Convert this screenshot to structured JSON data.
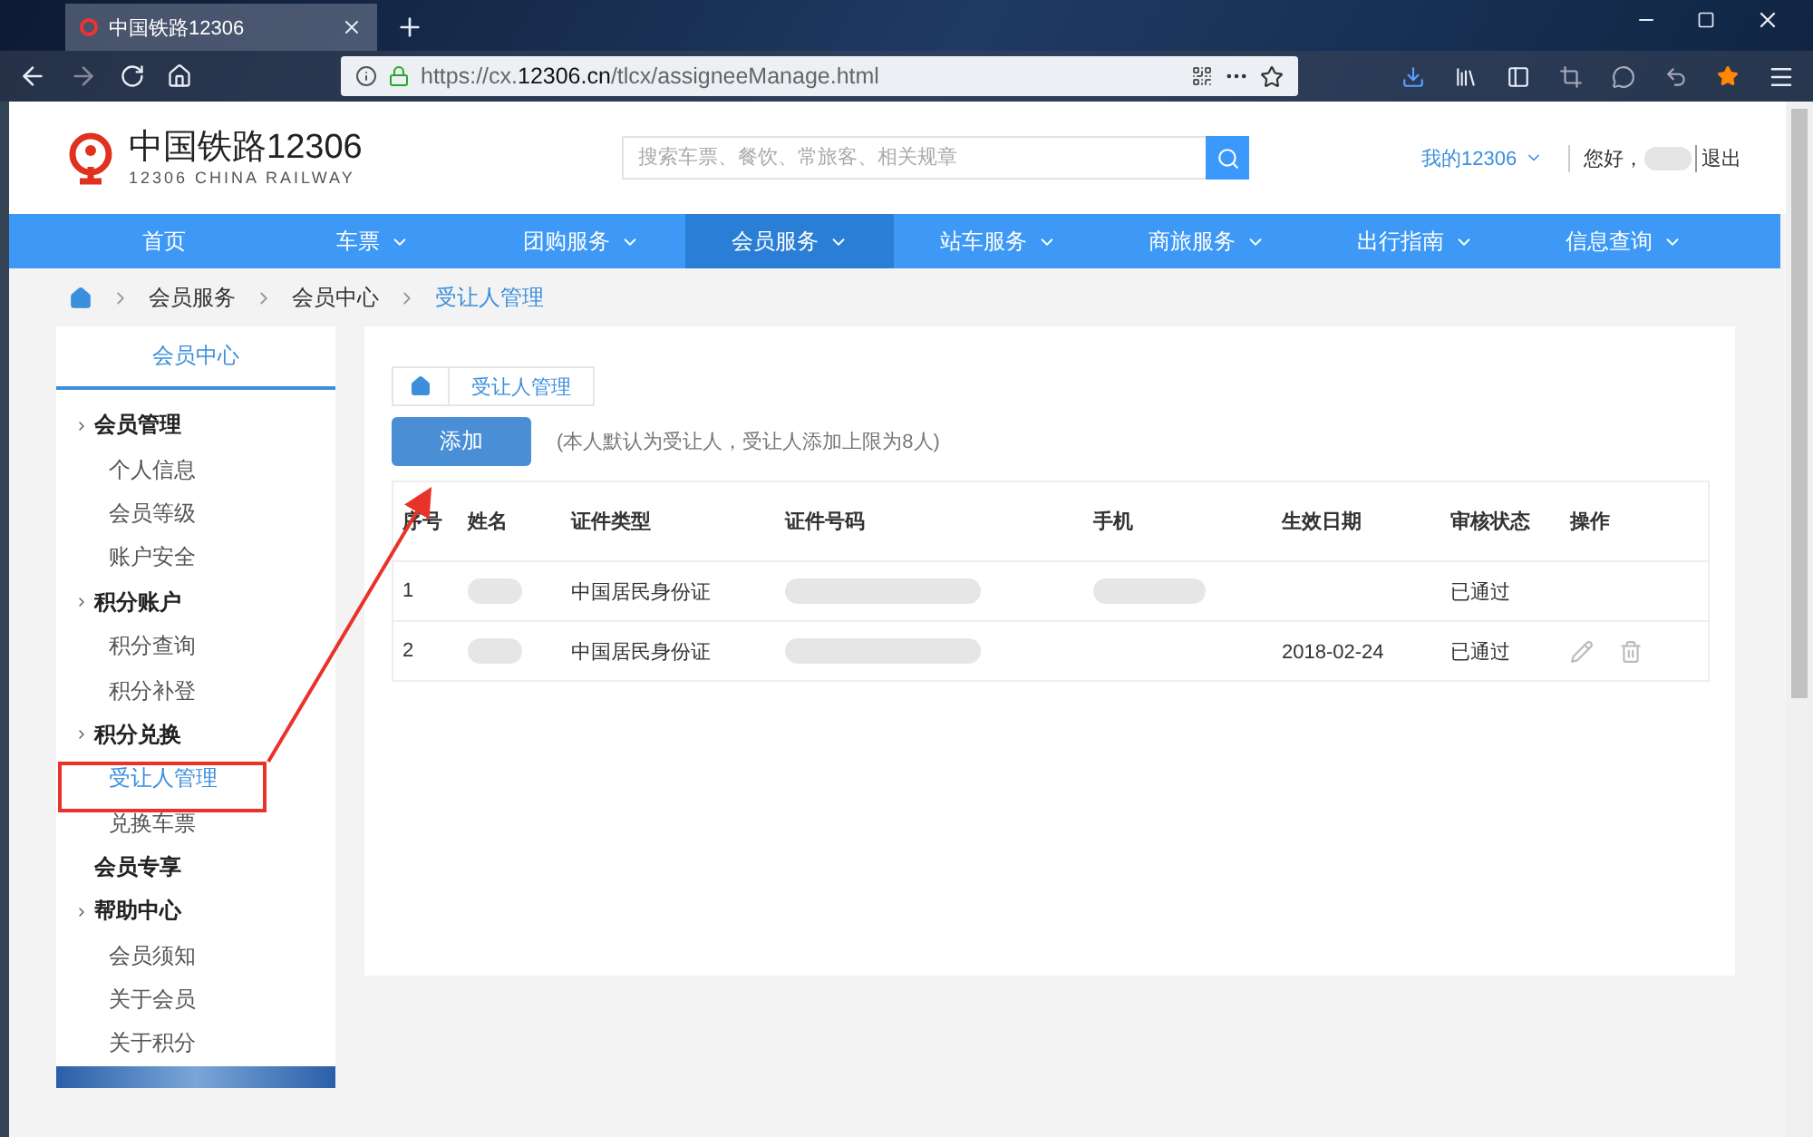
{
  "browser": {
    "tab": {
      "title": "中国铁路12306"
    },
    "url": "https://cx.**12306.cn**/tlcx/assigneeManage.html"
  },
  "header": {
    "logo_title": "中国铁路12306",
    "logo_subtitle": "12306 CHINA RAILWAY",
    "search": {
      "placeholder": "搜索车票、餐饮、常旅客、相关规章"
    },
    "account_menu": "我的12306",
    "greeting": "您好，",
    "logout": "退出"
  },
  "nav": [
    {
      "label": "首页",
      "dropdown": false,
      "selected": false
    },
    {
      "label": "车票",
      "dropdown": true,
      "selected": false
    },
    {
      "label": "团购服务",
      "dropdown": true,
      "selected": false
    },
    {
      "label": "会员服务",
      "dropdown": true,
      "selected": true
    },
    {
      "label": "站车服务",
      "dropdown": true,
      "selected": false
    },
    {
      "label": "商旅服务",
      "dropdown": true,
      "selected": false
    },
    {
      "label": "出行指南",
      "dropdown": true,
      "selected": false
    },
    {
      "label": "信息查询",
      "dropdown": true,
      "selected": false
    }
  ],
  "breadcrumb": [
    "会员服务",
    "会员中心",
    "受让人管理"
  ],
  "sidebar": {
    "title": "会员中心",
    "groups": [
      {
        "label": "会员管理",
        "expandable": true,
        "children": [
          {
            "label": "个人信息",
            "selected": false
          },
          {
            "label": "会员等级",
            "selected": false
          },
          {
            "label": "账户安全",
            "selected": false
          }
        ]
      },
      {
        "label": "积分账户",
        "expandable": true,
        "children": [
          {
            "label": "积分查询",
            "selected": false
          },
          {
            "label": "积分补登",
            "selected": false
          }
        ]
      },
      {
        "label": "积分兑换",
        "expandable": true,
        "children": [
          {
            "label": "受让人管理",
            "selected": true
          },
          {
            "label": "兑换车票",
            "selected": false
          }
        ]
      },
      {
        "label": "会员专享",
        "expandable": false
      },
      {
        "label": "帮助中心",
        "expandable": true,
        "children": [
          {
            "label": "会员须知",
            "selected": false
          },
          {
            "label": "关于会员",
            "selected": false
          },
          {
            "label": "关于积分",
            "selected": false
          }
        ]
      }
    ]
  },
  "panel": {
    "breadcrumb": "受让人管理",
    "add_button": "添加",
    "note": "(本人默认为受让人，受让人添加上限为8人)",
    "table": {
      "columns": [
        "序号",
        "姓名",
        "证件类型",
        "证件号码",
        "手机",
        "生效日期",
        "审核状态",
        "操作"
      ],
      "rows": [
        {
          "index": "1",
          "name_redacted": true,
          "id_type": "中国居民身份证",
          "id_number_redacted": true,
          "phone_redacted": true,
          "status": "已通过",
          "actions": false
        },
        {
          "index": "2",
          "name_redacted": true,
          "id_type": "中国居民身份证",
          "id_number_redacted": true,
          "phone_redacted": false,
          "valid_date": "2018-02-24",
          "status": "已通过",
          "actions": true
        }
      ]
    }
  }
}
